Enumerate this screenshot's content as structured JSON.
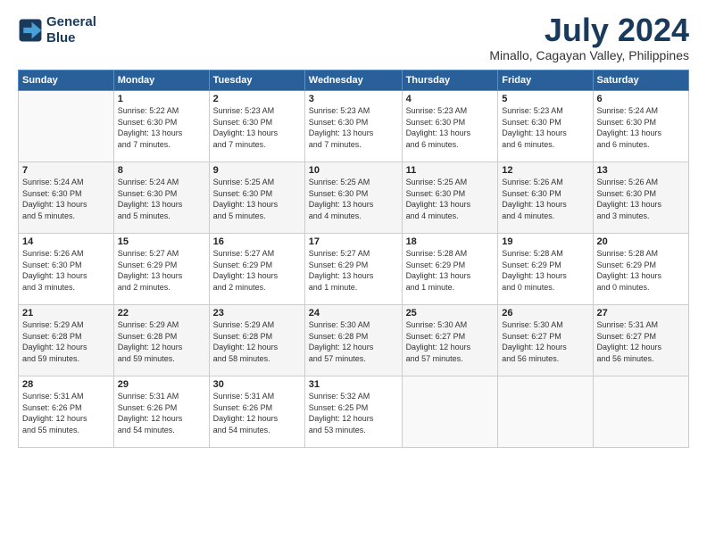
{
  "header": {
    "logo_line1": "General",
    "logo_line2": "Blue",
    "month_year": "July 2024",
    "location": "Minallo, Cagayan Valley, Philippines"
  },
  "weekdays": [
    "Sunday",
    "Monday",
    "Tuesday",
    "Wednesday",
    "Thursday",
    "Friday",
    "Saturday"
  ],
  "weeks": [
    [
      {
        "day": "",
        "info": ""
      },
      {
        "day": "1",
        "info": "Sunrise: 5:22 AM\nSunset: 6:30 PM\nDaylight: 13 hours\nand 7 minutes."
      },
      {
        "day": "2",
        "info": "Sunrise: 5:23 AM\nSunset: 6:30 PM\nDaylight: 13 hours\nand 7 minutes."
      },
      {
        "day": "3",
        "info": "Sunrise: 5:23 AM\nSunset: 6:30 PM\nDaylight: 13 hours\nand 7 minutes."
      },
      {
        "day": "4",
        "info": "Sunrise: 5:23 AM\nSunset: 6:30 PM\nDaylight: 13 hours\nand 6 minutes."
      },
      {
        "day": "5",
        "info": "Sunrise: 5:23 AM\nSunset: 6:30 PM\nDaylight: 13 hours\nand 6 minutes."
      },
      {
        "day": "6",
        "info": "Sunrise: 5:24 AM\nSunset: 6:30 PM\nDaylight: 13 hours\nand 6 minutes."
      }
    ],
    [
      {
        "day": "7",
        "info": "Sunrise: 5:24 AM\nSunset: 6:30 PM\nDaylight: 13 hours\nand 5 minutes."
      },
      {
        "day": "8",
        "info": "Sunrise: 5:24 AM\nSunset: 6:30 PM\nDaylight: 13 hours\nand 5 minutes."
      },
      {
        "day": "9",
        "info": "Sunrise: 5:25 AM\nSunset: 6:30 PM\nDaylight: 13 hours\nand 5 minutes."
      },
      {
        "day": "10",
        "info": "Sunrise: 5:25 AM\nSunset: 6:30 PM\nDaylight: 13 hours\nand 4 minutes."
      },
      {
        "day": "11",
        "info": "Sunrise: 5:25 AM\nSunset: 6:30 PM\nDaylight: 13 hours\nand 4 minutes."
      },
      {
        "day": "12",
        "info": "Sunrise: 5:26 AM\nSunset: 6:30 PM\nDaylight: 13 hours\nand 4 minutes."
      },
      {
        "day": "13",
        "info": "Sunrise: 5:26 AM\nSunset: 6:30 PM\nDaylight: 13 hours\nand 3 minutes."
      }
    ],
    [
      {
        "day": "14",
        "info": "Sunrise: 5:26 AM\nSunset: 6:30 PM\nDaylight: 13 hours\nand 3 minutes."
      },
      {
        "day": "15",
        "info": "Sunrise: 5:27 AM\nSunset: 6:29 PM\nDaylight: 13 hours\nand 2 minutes."
      },
      {
        "day": "16",
        "info": "Sunrise: 5:27 AM\nSunset: 6:29 PM\nDaylight: 13 hours\nand 2 minutes."
      },
      {
        "day": "17",
        "info": "Sunrise: 5:27 AM\nSunset: 6:29 PM\nDaylight: 13 hours\nand 1 minute."
      },
      {
        "day": "18",
        "info": "Sunrise: 5:28 AM\nSunset: 6:29 PM\nDaylight: 13 hours\nand 1 minute."
      },
      {
        "day": "19",
        "info": "Sunrise: 5:28 AM\nSunset: 6:29 PM\nDaylight: 13 hours\nand 0 minutes."
      },
      {
        "day": "20",
        "info": "Sunrise: 5:28 AM\nSunset: 6:29 PM\nDaylight: 13 hours\nand 0 minutes."
      }
    ],
    [
      {
        "day": "21",
        "info": "Sunrise: 5:29 AM\nSunset: 6:28 PM\nDaylight: 12 hours\nand 59 minutes."
      },
      {
        "day": "22",
        "info": "Sunrise: 5:29 AM\nSunset: 6:28 PM\nDaylight: 12 hours\nand 59 minutes."
      },
      {
        "day": "23",
        "info": "Sunrise: 5:29 AM\nSunset: 6:28 PM\nDaylight: 12 hours\nand 58 minutes."
      },
      {
        "day": "24",
        "info": "Sunrise: 5:30 AM\nSunset: 6:28 PM\nDaylight: 12 hours\nand 57 minutes."
      },
      {
        "day": "25",
        "info": "Sunrise: 5:30 AM\nSunset: 6:27 PM\nDaylight: 12 hours\nand 57 minutes."
      },
      {
        "day": "26",
        "info": "Sunrise: 5:30 AM\nSunset: 6:27 PM\nDaylight: 12 hours\nand 56 minutes."
      },
      {
        "day": "27",
        "info": "Sunrise: 5:31 AM\nSunset: 6:27 PM\nDaylight: 12 hours\nand 56 minutes."
      }
    ],
    [
      {
        "day": "28",
        "info": "Sunrise: 5:31 AM\nSunset: 6:26 PM\nDaylight: 12 hours\nand 55 minutes."
      },
      {
        "day": "29",
        "info": "Sunrise: 5:31 AM\nSunset: 6:26 PM\nDaylight: 12 hours\nand 54 minutes."
      },
      {
        "day": "30",
        "info": "Sunrise: 5:31 AM\nSunset: 6:26 PM\nDaylight: 12 hours\nand 54 minutes."
      },
      {
        "day": "31",
        "info": "Sunrise: 5:32 AM\nSunset: 6:25 PM\nDaylight: 12 hours\nand 53 minutes."
      },
      {
        "day": "",
        "info": ""
      },
      {
        "day": "",
        "info": ""
      },
      {
        "day": "",
        "info": ""
      }
    ]
  ]
}
